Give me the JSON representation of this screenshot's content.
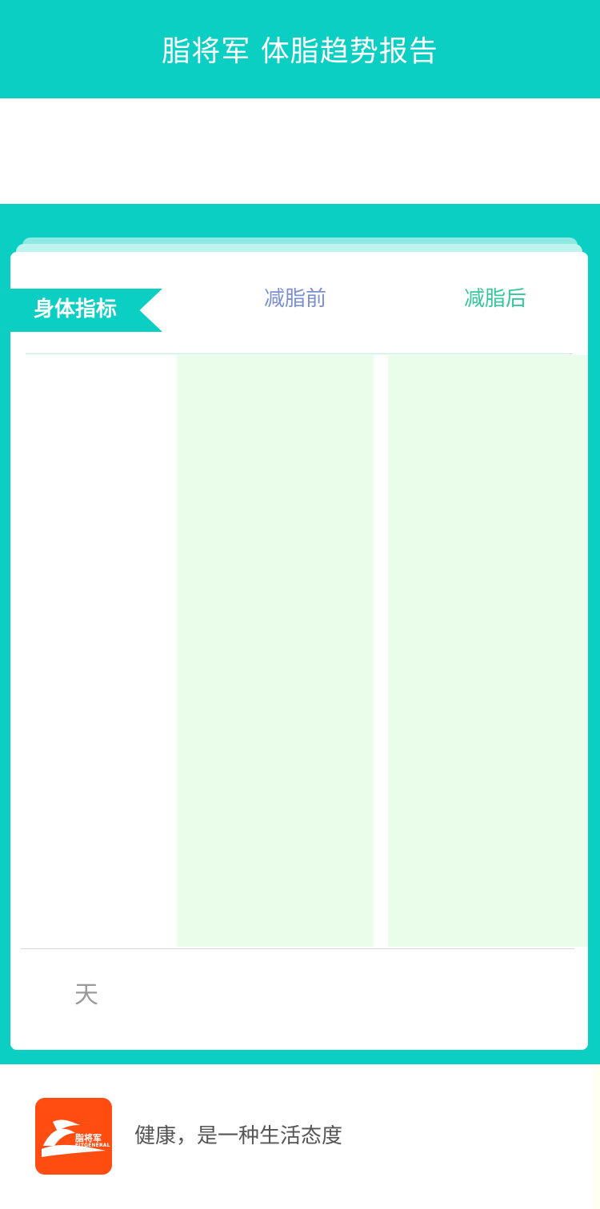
{
  "header": {
    "title": "脂将军 体脂趋势报告"
  },
  "card": {
    "ribbon_label": "身体指标",
    "col_before": "减脂前",
    "col_after": "减脂后",
    "day_label": "天"
  },
  "footer": {
    "logo_cn": "脂将军",
    "logo_en": "FITGENERAL",
    "slogan": "健康，是一种生活态度"
  },
  "colors": {
    "teal": "#0ccfc4",
    "before": "#7b8fd1",
    "after": "#35c79c",
    "panel": "#eafdea",
    "logo": "#ff4d12"
  }
}
